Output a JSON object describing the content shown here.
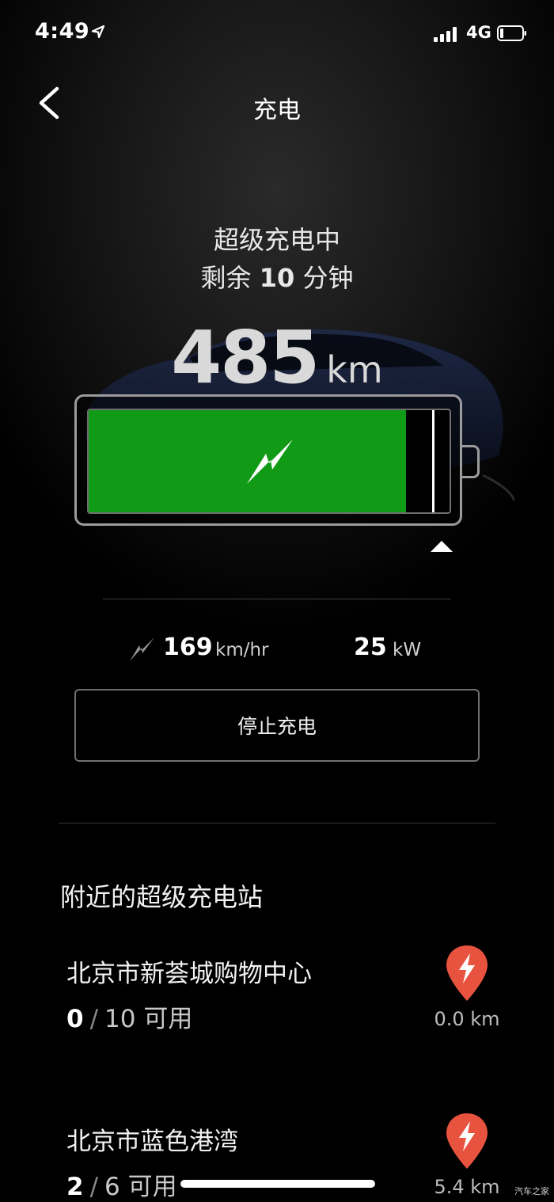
{
  "status_bar": {
    "time": "4:49",
    "network": "4G",
    "icons": [
      "location-arrow-icon",
      "signal-bars-icon",
      "battery-low-icon"
    ]
  },
  "nav": {
    "title": "充电",
    "back_icon": "chevron-left-icon"
  },
  "charging": {
    "status": "超级充电中",
    "remaining_prefix": "剩余",
    "remaining_value": "10",
    "remaining_unit": "分钟",
    "range_value": "485",
    "range_unit": "km",
    "battery_level": 0.88,
    "charge_limit": 0.95,
    "fill_color": "#119a16",
    "charging_icon": "lightning-bolt-icon",
    "rate_icon": "charge-rate-icon",
    "rate_value": "169",
    "rate_unit": "km/hr",
    "power_value": "25",
    "power_unit": "kW",
    "stop_button_label": "停止充电"
  },
  "nearby": {
    "section_title": "附近的超级充电站",
    "pin_color": "#e8533f",
    "stations": [
      {
        "name": "北京市新荟城购物中心",
        "available": "0",
        "total": "10",
        "available_label": "可用",
        "distance": "0.0 km"
      },
      {
        "name": "北京市蓝色港湾",
        "available": "2",
        "total": "6",
        "available_label": "可用",
        "distance": "5.4 km"
      }
    ]
  },
  "watermark": "汽车之家"
}
